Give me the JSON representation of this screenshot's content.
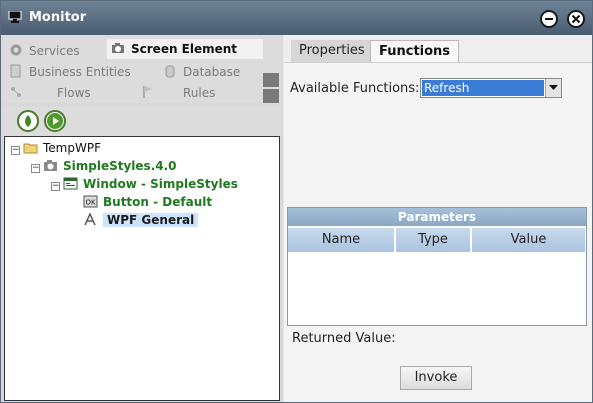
{
  "window": {
    "title": "Monitor"
  },
  "nav": {
    "items": [
      {
        "label": "Services",
        "icon": "gear-icon"
      },
      {
        "label": "Screen Element",
        "icon": "camera-icon",
        "active": true
      },
      {
        "label": "Business Entities",
        "icon": "entity-icon"
      },
      {
        "label": "Database",
        "icon": "database-icon"
      },
      {
        "label": "Flows",
        "icon": "flow-icon"
      },
      {
        "label": "Rules",
        "icon": "flag-icon"
      }
    ]
  },
  "tree": {
    "nodes": [
      {
        "label": "TempWPF"
      },
      {
        "label": "SimpleStyles.4.0"
      },
      {
        "label": "Window - SimpleStyles"
      },
      {
        "label": "Button - Default"
      },
      {
        "label": "WPF General"
      }
    ]
  },
  "tabs": {
    "properties": "Properties",
    "functions": "Functions"
  },
  "functions": {
    "available_label": "Available Functions:",
    "selected": "Refresh",
    "parameters_title": "Parameters",
    "columns": [
      "Name",
      "Type",
      "Value"
    ],
    "returned_label": "Returned Value:",
    "invoke_label": "Invoke"
  },
  "colors": {
    "titlebar": "#5b6d80",
    "selection": "#3a7bd5",
    "tree_bold": "#1e7a1e",
    "param_header": "#aac3df"
  }
}
